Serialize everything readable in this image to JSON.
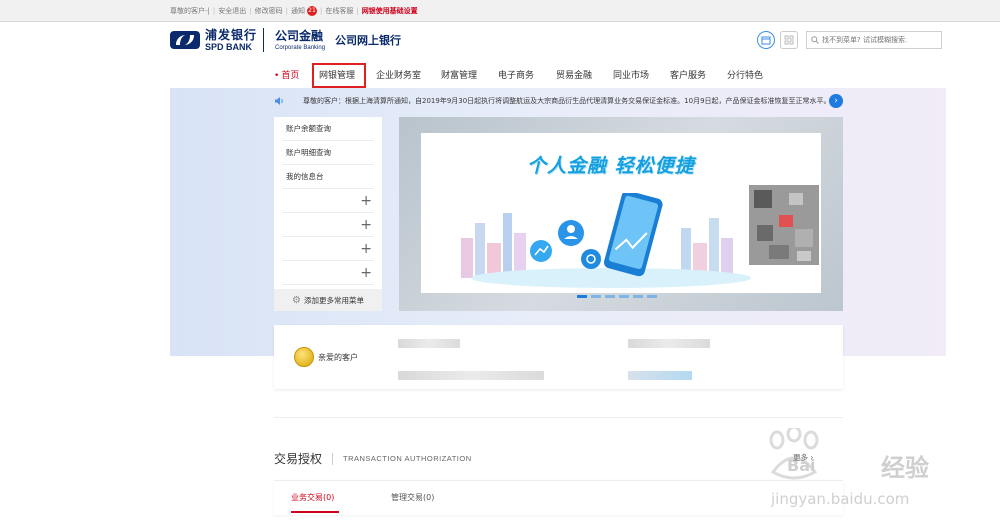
{
  "topbar": {
    "greeting": "尊敬的客户-|",
    "logout": "安全退出",
    "change_password": "修改密码",
    "notice": "通知",
    "notice_count": "21",
    "online_service": "在线客服",
    "setup": "网银使用基础设置"
  },
  "header": {
    "brand_cn": "浦发银行",
    "brand_en": "SPD BANK",
    "corp_cn": "公司金融",
    "corp_en": "Corporate Banking",
    "online_bank": "公司网上银行",
    "search_placeholder": "找不到菜单? 试试模糊搜索."
  },
  "nav": {
    "items": [
      "首页",
      "网银管理",
      "企业财务室",
      "财富管理",
      "电子商务",
      "贸易金融",
      "同业市场",
      "客户服务",
      "分行特色"
    ]
  },
  "notice_bar": {
    "text": "尊敬的客户：根据上海清算所通知，自2019年9月30日起执行将调整航运及大宗商品衍生品代理清算业务交易保证金标准。10月9日起，产品保证金标准恢复至正常水平。各交"
  },
  "quick_menu": {
    "items": [
      "账户余额查询",
      "账户明细查询",
      "我的信息台"
    ],
    "add_more": "添加更多常用菜单"
  },
  "banner": {
    "slogan": "个人金融 轻松便捷"
  },
  "welcome": {
    "greeting": "亲爱的客户"
  },
  "section": {
    "title": "交易授权",
    "subtitle": "TRANSACTION AUTHORIZATION",
    "more": "更多 ›"
  },
  "tabs": {
    "business": "业务交易(0)",
    "management": "管理交易(0)"
  },
  "watermark": {
    "cn": "经验",
    "brand": "Bai",
    "url": "jingyan.baidu.com"
  },
  "colors": {
    "brand": "#0b2a6b",
    "accent": "#d0021b",
    "link": "#1e7be0"
  }
}
